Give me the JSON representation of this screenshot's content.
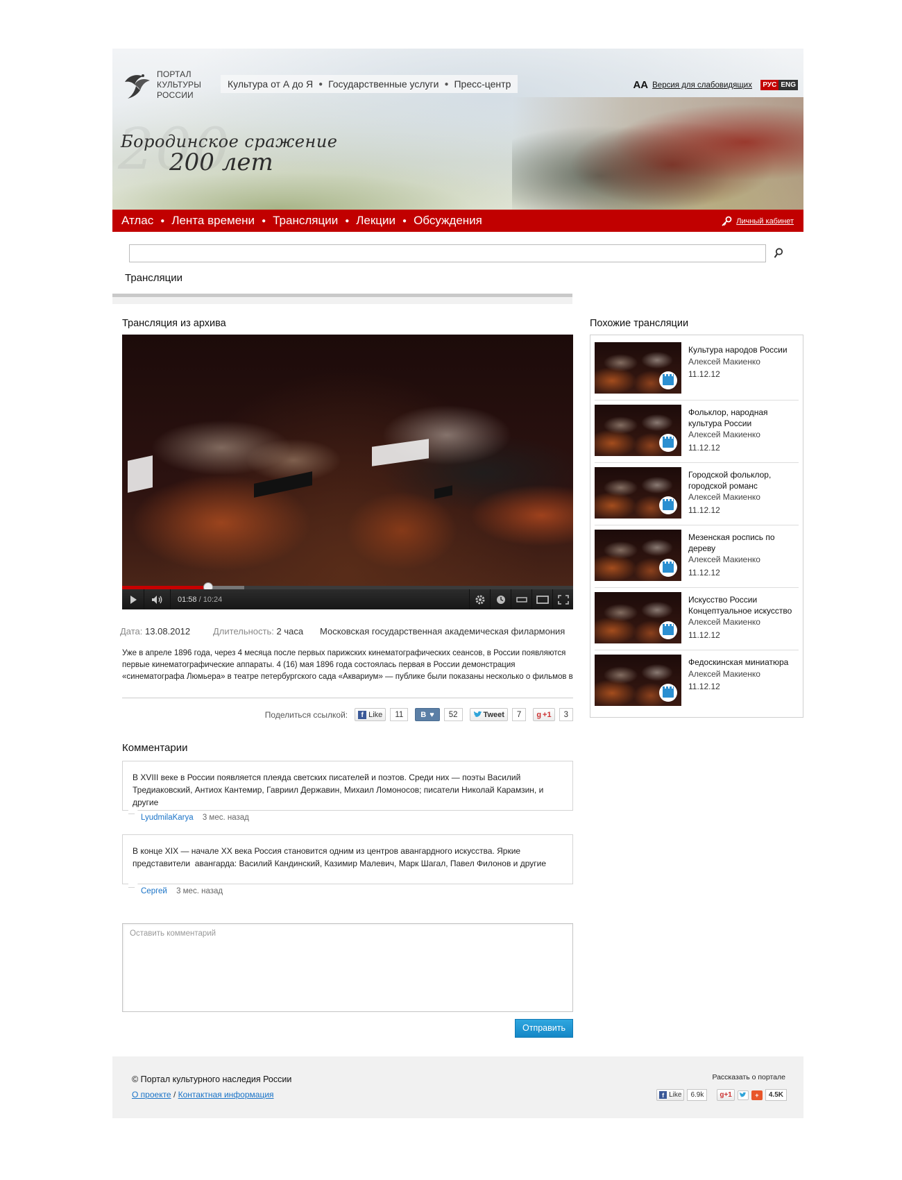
{
  "header": {
    "logo_lines": [
      "ПОРТАЛ",
      "КУЛЬТУРЫ",
      "РОССИИ"
    ],
    "top_nav": [
      "Культура от А до Я",
      "Государственные услуги",
      "Пресс-центр"
    ],
    "accessibility_glyph": "AA",
    "accessibility_link": "Версия для слабовидящих",
    "lang_ru": "РУС",
    "lang_en": "ENG",
    "title_line1": "Бородинское сражение",
    "title_line2": "200 лет",
    "title_ghost": "200"
  },
  "main_nav": {
    "items": [
      "Атлас",
      "Лента времени",
      "Трансляции",
      "Лекции",
      "Обсуждения"
    ],
    "cabinet": "Личный кабинет"
  },
  "search": {
    "value": "",
    "placeholder": ""
  },
  "section_title": "Трансляции",
  "broadcast": {
    "heading": "Трансляция из архива",
    "player": {
      "current_time": "01:58",
      "duration": "/ 10:24",
      "progress_fraction": 0.19,
      "buffered_fraction": 0.27
    },
    "date_label": "Дата:",
    "date_value": "13.08.2012",
    "duration_label": "Длительность:",
    "duration_value": "2 часа",
    "venue": "Московская государственная академическая филармония",
    "description": "Уже в апреле 1896 года, через 4 месяца после первых парижских кинематографических сеансов, в России появляются первые кинематографические аппараты. 4 (16) мая 1896 года состоялась первая в России демонстрация «синематографа Люмьера» в театре петербургского сада «Аквариум» — публике были показаны несколько о фильмов в"
  },
  "share": {
    "label": "Поделиться ссылкой:",
    "fb_label": "Like",
    "fb_count": "11",
    "vk_label": "В",
    "vk_count": "52",
    "tw_label": "Tweet",
    "tw_count": "7",
    "gp_label": "+1",
    "gp_count": "3"
  },
  "comments": {
    "title": "Комментарии",
    "items": [
      {
        "text": "В XVIII веке в России появляется плеяда светских писателей и поэтов. Среди них — поэты Василий Тредиаковский, Антиох Кантемир, Гавриил Державин, Михаил Ломоносов; писатели Николай Карамзин, и другие",
        "author": "LyudmilaKarya",
        "ago": "3 мес. назад"
      },
      {
        "text": "В конце XIX — начале XX века Россия становится одним из центров авангардного искусства. Яркие представители  авангарда: Василий Кандинский, Казимир Малевич, Марк Шагал, Павел Филонов и другие",
        "author": "Сергей",
        "ago": "3 мес. назад"
      }
    ],
    "leave_placeholder": "Оставить комментарий",
    "submit": "Отправить"
  },
  "similar": {
    "title": "Похожие  трансляции",
    "items": [
      {
        "title": "Культура народов России",
        "author": "Алексей Макиенко",
        "date": "11.12.12"
      },
      {
        "title": "Фольклор, народная культура России",
        "author": "Алексей Макиенко",
        "date": "11.12.12"
      },
      {
        "title": "Городской фольклор, городской романс",
        "author": "Алексей Макиенко",
        "date": "11.12.12"
      },
      {
        "title": "Мезенская роспись по дереву",
        "author": "Алексей Макиенко",
        "date": "11.12.12"
      },
      {
        "title": "Искусство России Концептуальное искусство",
        "author": "Алексей Макиенко",
        "date": "11.12.12"
      },
      {
        "title": "Федоскинская миниатюра",
        "author": "Алексей Макиенко",
        "date": "11.12.12"
      }
    ]
  },
  "footer": {
    "copyright": "© Портал культурного наследия России",
    "about": "О проекте",
    "slash": "/",
    "contacts": "Контактная информация",
    "tell": "Рассказать о портале",
    "fb_label": "Like",
    "fb_count": "6.9k",
    "gp_label": "+1",
    "share_count": "4.5K"
  },
  "colors": {
    "brand_red": "#c10000",
    "link_blue": "#1a73c7",
    "button_blue": "#1487c6"
  }
}
